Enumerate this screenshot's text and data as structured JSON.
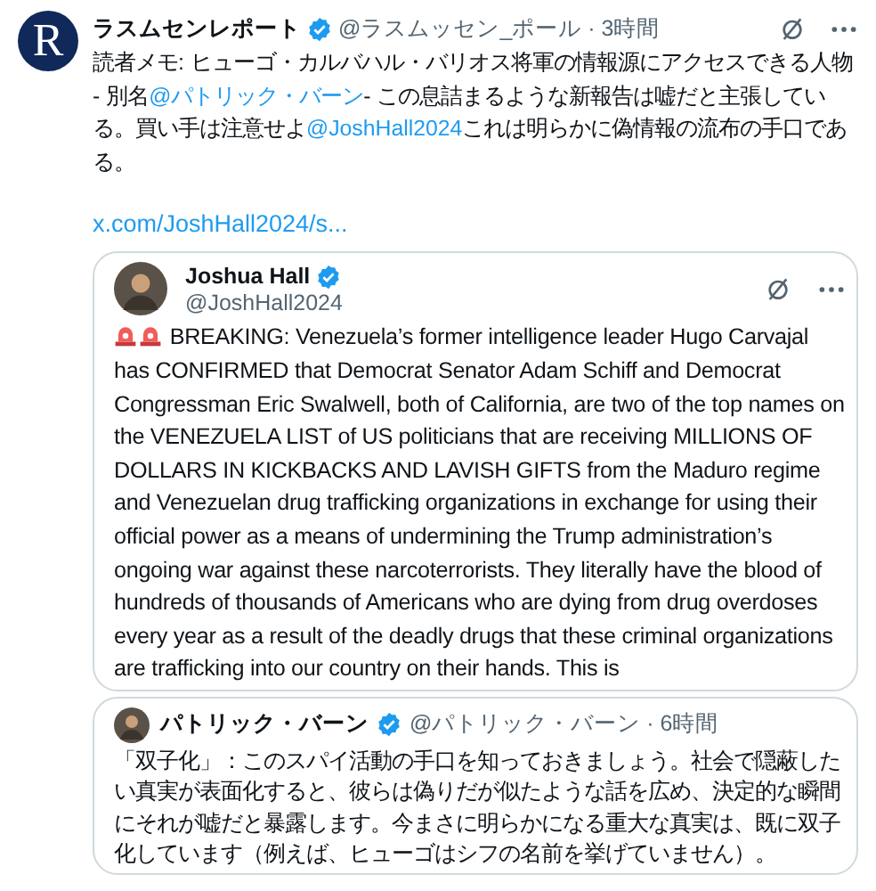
{
  "post": {
    "author": {
      "name": "ラスムセンレポート",
      "handle_time": "@ラスムッセン_ポール · 3時間",
      "logo_letter": "R",
      "verified": true
    },
    "body": [
      {
        "kind": "text",
        "text": "読者メモ: ヒューゴ・カルバハル・バリオス将軍の情報源にアクセスできる人物 - 別名"
      },
      {
        "kind": "mention",
        "text": "@パトリック・バーン"
      },
      {
        "kind": "text",
        "text": "- この息詰まるような新報告は嘘だと主張している。買い手は注意せよ"
      },
      {
        "kind": "mention",
        "text": "@JoshHall2024"
      },
      {
        "kind": "text",
        "text": "これは明らかに偽情報の流布の手口である。"
      }
    ],
    "link": "x.com/JoshHall2024/s...",
    "quotes": [
      {
        "author": {
          "name": "Joshua Hall",
          "handle": "@JoshHall2024",
          "verified": true
        },
        "kind": "stacked",
        "lead_icons": [
          {
            "kind": "siren"
          },
          {
            "kind": "siren"
          }
        ],
        "text": "BREAKING: Venezuela’s former intelligence leader Hugo Carvajal has CONFIRMED that Democrat Senator Adam Schiff and Democrat Congressman Eric Swalwell, both of California, are two of the top names on the VENEZUELA LIST of US politicians that are receiving MILLIONS OF DOLLARS IN KICKBACKS AND LAVISH GIFTS from the Maduro regime and Venezuelan drug trafficking organizations in exchange for using their official power as a means of undermining the Trump administration’s ongoing war against these narcoterrorists. They literally have the blood of hundreds of thousands of Americans who are dying from drug overdoses every year as a result of the deadly drugs that these criminal organizations are trafficking into our country on their hands. This is"
      },
      {
        "author": {
          "name": "パトリック・バーン",
          "handle_time": "@パトリック・バーン · 6時間",
          "verified": true
        },
        "kind": "inline",
        "text": "「双子化」：このスパイ活動の手口を知っておきましょう。社会で隠蔽したい真実が表面化すると、彼らは偽りだが似たような話を広め、決定的な瞬間にそれが嘘だと暴露します。今まさに明らかになる重大な真実は、既に双子化しています（例えば、ヒューゴはシフの名前を挙げていません）。"
      }
    ]
  }
}
